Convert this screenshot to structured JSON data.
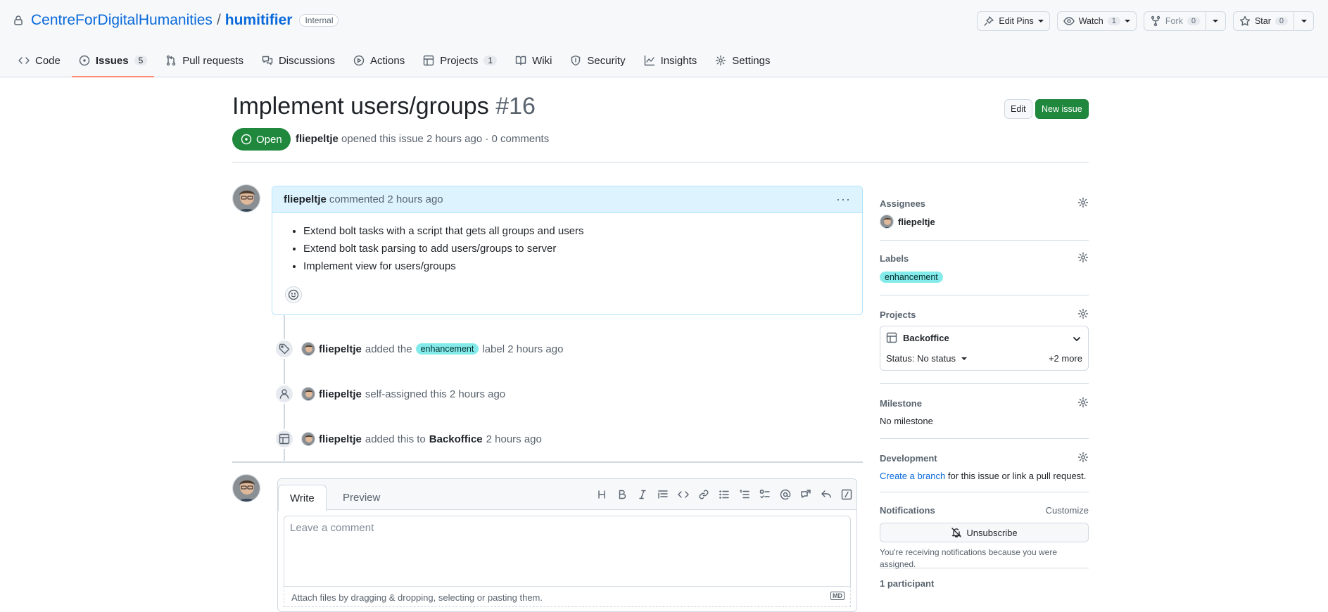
{
  "repo": {
    "owner": "CentreForDigitalHumanities",
    "separator": "/",
    "name": "humitifier",
    "visibility": "Internal"
  },
  "header_actions": {
    "edit_pins": "Edit Pins",
    "watch": {
      "label": "Watch",
      "count": "1"
    },
    "fork": {
      "label": "Fork",
      "count": "0"
    },
    "star": {
      "label": "Star",
      "count": "0"
    }
  },
  "tabs": [
    {
      "label": "Code",
      "count": null,
      "icon": "code-icon"
    },
    {
      "label": "Issues",
      "count": "5",
      "icon": "issue-opened-icon",
      "active": true
    },
    {
      "label": "Pull requests",
      "count": null,
      "icon": "git-pull-request-icon"
    },
    {
      "label": "Discussions",
      "count": null,
      "icon": "comment-discussion-icon"
    },
    {
      "label": "Actions",
      "count": null,
      "icon": "play-icon"
    },
    {
      "label": "Projects",
      "count": "1",
      "icon": "table-icon"
    },
    {
      "label": "Wiki",
      "count": null,
      "icon": "book-icon"
    },
    {
      "label": "Security",
      "count": null,
      "icon": "shield-icon"
    },
    {
      "label": "Insights",
      "count": null,
      "icon": "graph-icon"
    },
    {
      "label": "Settings",
      "count": null,
      "icon": "gear-icon"
    }
  ],
  "issue": {
    "title": "Implement users/groups",
    "number": "#16",
    "edit_label": "Edit",
    "new_label": "New issue",
    "state": "Open",
    "author": "fliepeltje",
    "meta": "opened this issue 2 hours ago · 0 comments"
  },
  "comment": {
    "author": "fliepeltje",
    "action": "commented",
    "time": "2 hours ago",
    "more": "···",
    "items": [
      "Extend bolt tasks with a script that gets all groups and users",
      "Extend bolt task parsing to add users/groups to server",
      "Implement view for users/groups"
    ]
  },
  "timeline": [
    {
      "icon": "tag-icon",
      "actor": "fliepeltje",
      "pre": "added the",
      "label": "enhancement",
      "post": "label 2 hours ago"
    },
    {
      "icon": "person-icon",
      "actor": "fliepeltje",
      "pre": "self-assigned this 2 hours ago"
    },
    {
      "icon": "table-icon",
      "actor": "fliepeltje",
      "pre": "added this to",
      "target": "Backoffice",
      "post": "2 hours ago"
    }
  ],
  "composer": {
    "tab_write": "Write",
    "tab_preview": "Preview",
    "placeholder": "Leave a comment",
    "footer": "Attach files by dragging & dropping, selecting or pasting them.",
    "md_badge": "MD"
  },
  "sidebar": {
    "assignees": {
      "heading": "Assignees",
      "value": "fliepeltje"
    },
    "labels": {
      "heading": "Labels",
      "value": "enhancement"
    },
    "projects": {
      "heading": "Projects",
      "name": "Backoffice",
      "status": "Status: No status",
      "more": "+2 more"
    },
    "milestone": {
      "heading": "Milestone",
      "value": "No milestone"
    },
    "development": {
      "heading": "Development",
      "link": "Create a branch",
      "text": "for this issue or link a pull request."
    },
    "notifications": {
      "heading": "Notifications",
      "customize": "Customize",
      "button": "Unsubscribe",
      "text": "You're receiving notifications because you were assigned."
    },
    "participants": {
      "heading": "1 participant"
    }
  },
  "colors": {
    "accent": "#0969da",
    "open_green": "#1f883d",
    "label_enhancement": "#84ebea",
    "active_tab": "#fd8c73"
  }
}
